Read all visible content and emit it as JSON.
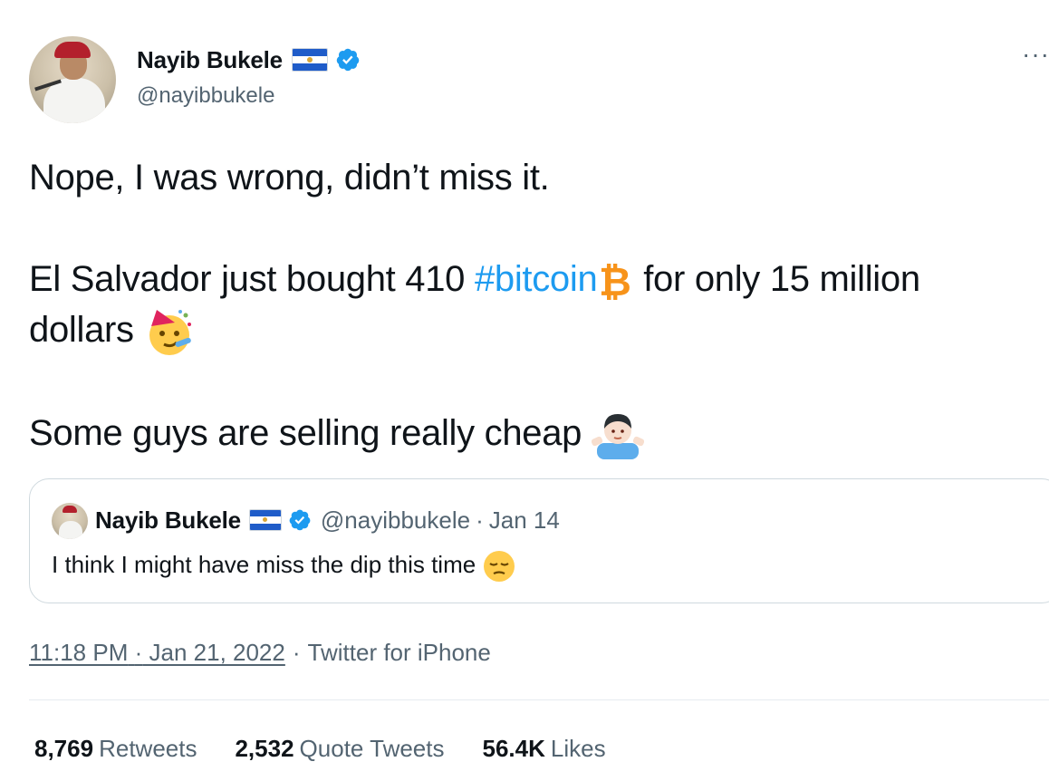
{
  "author": {
    "name": "Nayib Bukele",
    "handle": "@nayibbukele"
  },
  "tweet": {
    "line1": "Nope, I was wrong, didn’t miss it.",
    "line2_prefix": "El Salvador just bought 410 ",
    "line2_hashtag": "#bitcoin",
    "line2_suffix": "  for only 15 million dollars",
    "line3": "Some guys are selling really cheap"
  },
  "quoted": {
    "name": "Nayib Bukele",
    "handle": "@nayibbukele",
    "separator": "·",
    "date": "Jan 14",
    "text": "I think I might have miss the dip this time"
  },
  "meta": {
    "time": "11:18 PM",
    "dot1": "·",
    "date": "Jan 21, 2022",
    "dot2": "·",
    "source": "Twitter for iPhone"
  },
  "stats": {
    "retweets_count": "8,769",
    "retweets_label": "Retweets",
    "quotes_count": "2,532",
    "quotes_label": "Quote Tweets",
    "likes_count": "56.4K",
    "likes_label": "Likes"
  },
  "icons": {
    "more": "more-options-icon",
    "verified": "verified-badge-icon",
    "flag": "el-salvador-flag-icon",
    "bitcoin": "bitcoin-icon",
    "party": "partying-face-emoji",
    "shrug": "person-shrugging-emoji",
    "pensive": "pensive-face-emoji"
  },
  "colors": {
    "link": "#1d9bf0",
    "secondary": "#536471",
    "text": "#0f1419",
    "bitcoin": "#f7931a",
    "verified": "#1d9bf0"
  }
}
